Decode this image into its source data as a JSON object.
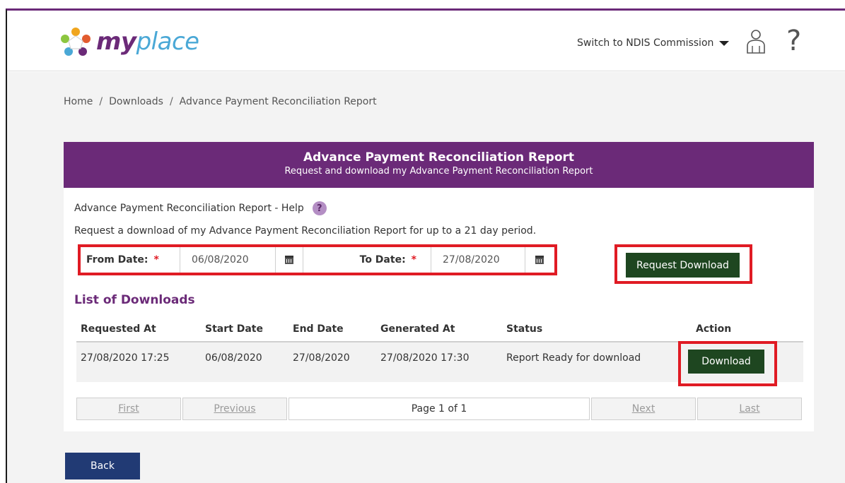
{
  "header": {
    "logo_my": "my",
    "logo_place": "place",
    "switch_label": "Switch to NDIS Commission",
    "help_glyph": "?"
  },
  "breadcrumb": {
    "items": [
      "Home",
      "Downloads",
      "Advance Payment Reconciliation Report"
    ],
    "separator": "/"
  },
  "panel": {
    "title": "Advance Payment Reconciliation Report",
    "subtitle": "Request and download my Advance Payment Reconciliation Report",
    "help_text": "Advance Payment Reconciliation Report - Help",
    "help_badge": "?",
    "description": "Request a download of my Advance Payment Reconciliation Report for up to a 21 day period."
  },
  "form": {
    "from_label": "From Date:",
    "from_value": "06/08/2020",
    "to_label": "To Date:",
    "to_value": "27/08/2020",
    "required_mark": "*",
    "request_button": "Request Download"
  },
  "downloads": {
    "title": "List of Downloads",
    "columns": [
      "Requested At",
      "Start Date",
      "End Date",
      "Generated At",
      "Status",
      "Action"
    ],
    "rows": [
      {
        "requested_at": "27/08/2020 17:25",
        "start_date": "06/08/2020",
        "end_date": "27/08/2020",
        "generated_at": "27/08/2020 17:30",
        "status": "Report Ready for download",
        "action": "Download"
      }
    ]
  },
  "pager": {
    "first": "First",
    "previous": "Previous",
    "info": "Page 1 of 1",
    "next": "Next",
    "last": "Last"
  },
  "footer": {
    "back_button": "Back"
  },
  "colors": {
    "brand_purple": "#6b2a78",
    "brand_blue": "#4aa8d6",
    "action_green": "#1e4620",
    "back_blue": "#213a74",
    "highlight_red": "#e01b24"
  },
  "icons": [
    "myplace-logo-icon",
    "caret-down-icon",
    "user-icon",
    "help-icon",
    "calendar-icon"
  ]
}
